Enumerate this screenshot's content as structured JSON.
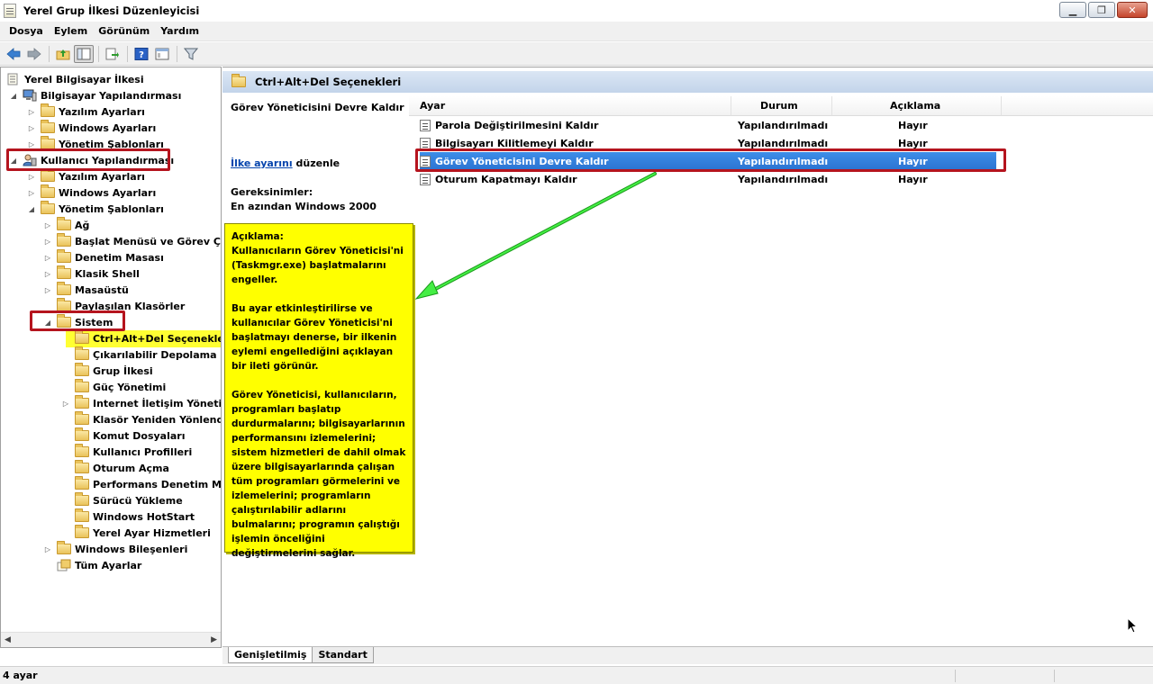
{
  "window": {
    "title": "Yerel Grup İlkesi Düzenleyicisi"
  },
  "menu": [
    "Dosya",
    "Eylem",
    "Görünüm",
    "Yardım"
  ],
  "tree": {
    "root": "Yerel Bilgisayar İlkesi",
    "computer_config": "Bilgisayar Yapılandırması",
    "comp_software": "Yazılım Ayarları",
    "comp_windows": "Windows Ayarları",
    "comp_admin": "Yönetim Şablonları",
    "user_config": "Kullanıcı Yapılandırması",
    "user_software": "Yazılım Ayarları",
    "user_windows": "Windows Ayarları",
    "user_admin": "Yönetim Şablonları",
    "admin_children": [
      "Ağ",
      "Başlat Menüsü ve Görev Çul",
      "Denetim Masası",
      "Klasik Shell",
      "Masaüstü",
      "Paylaşılan Klasörler",
      "Sistem"
    ],
    "system_children": [
      "Ctrl+Alt+Del Seçenekleri",
      "Çıkarılabilir Depolama Bi",
      "Grup İlkesi",
      "Güç Yönetimi",
      "Internet İletişim Yöneti",
      "Klasör Yeniden Yönlendir",
      "Komut Dosyaları",
      "Kullanıcı Profilleri",
      "Oturum Açma",
      "Performans Denetim Ma",
      "Sürücü Yükleme",
      "Windows HotStart",
      "Yerel Ayar Hizmetleri"
    ],
    "windows_components": "Windows Bileşenleri",
    "all_settings": "Tüm Ayarlar"
  },
  "right": {
    "header": "Ctrl+Alt+Del Seçenekleri",
    "desc_title": "Görev Yöneticisini Devre Kaldır",
    "edit_link": "İlke ayarını",
    "edit_suffix": " düzenle",
    "requirements_label": "Gereksinimler:",
    "requirements_value": "En azından Windows 2000",
    "note": "Açıklama:\nKullanıcıların Görev Yöneticisi'ni (Taskmgr.exe) başlatmalarını engeller.\n\nBu ayar etkinleştirilirse ve kullanıcılar Görev Yöneticisi'ni başlatmayı denerse, bir ilkenin eylemi engellediğini açıklayan bir ileti görünür.\n\nGörev Yöneticisi, kullanıcıların, programları başlatıp durdurmalarını; bilgisayarlarının performansını izlemelerini; sistem hizmetleri de dahil olmak üzere bilgisayarlarında çalışan tüm programları görmelerini ve izlemelerini; programların çalıştırılabilir adlarını bulmalarını; programın çalıştığı işlemin önceliğini değiştirmelerini sağlar.",
    "columns": {
      "setting": "Ayar",
      "state": "Durum",
      "comment": "Açıklama"
    },
    "rows": [
      {
        "setting": "Parola Değiştirilmesini Kaldır",
        "state": "Yapılandırılmadı",
        "comment": "Hayır"
      },
      {
        "setting": "Bilgisayarı Kilitlemeyi Kaldır",
        "state": "Yapılandırılmadı",
        "comment": "Hayır"
      },
      {
        "setting": "Görev Yöneticisini Devre Kaldır",
        "state": "Yapılandırılmadı",
        "comment": "Hayır"
      },
      {
        "setting": "Oturum Kapatmayı Kaldır",
        "state": "Yapılandırılmadı",
        "comment": "Hayır"
      }
    ],
    "tabs": [
      "Genişletilmiş",
      "Standart"
    ]
  },
  "status": {
    "text": "4 ayar"
  },
  "colors": {
    "highlight_red": "#b5141e",
    "note_yellow": "#ffff00",
    "arrow_green": "#33dd33",
    "selection_blue": "#2f7bd9"
  }
}
